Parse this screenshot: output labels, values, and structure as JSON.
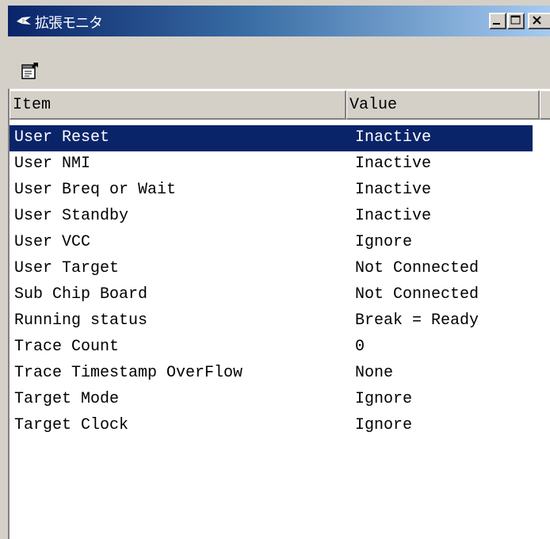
{
  "window": {
    "title": "拡張モニタ",
    "controls": {
      "minimize": "_",
      "maximize": "□",
      "close": "×"
    }
  },
  "toolbar": {
    "properties_icon": "properties-icon"
  },
  "columns": {
    "item": "Item",
    "value": "Value"
  },
  "rows": [
    {
      "item": "User Reset",
      "value": "Inactive",
      "selected": true
    },
    {
      "item": "User NMI",
      "value": "Inactive"
    },
    {
      "item": "User Breq or Wait",
      "value": "Inactive"
    },
    {
      "item": "User Standby",
      "value": "Inactive"
    },
    {
      "item": "User VCC",
      "value": "Ignore"
    },
    {
      "item": "User Target",
      "value": "Not Connected"
    },
    {
      "item": "Sub Chip Board",
      "value": "Not Connected"
    },
    {
      "item": "Running status",
      "value": "Break = Ready"
    },
    {
      "item": "Trace Count",
      "value": "0"
    },
    {
      "item": "Trace Timestamp OverFlow",
      "value": "None"
    },
    {
      "item": "Target Mode",
      "value": "Ignore"
    },
    {
      "item": "Target Clock",
      "value": "Ignore"
    }
  ],
  "colors": {
    "selection": "#0a246a",
    "titlebar_start": "#0a246a",
    "titlebar_end": "#a6caf0",
    "face": "#d4d0c8"
  }
}
